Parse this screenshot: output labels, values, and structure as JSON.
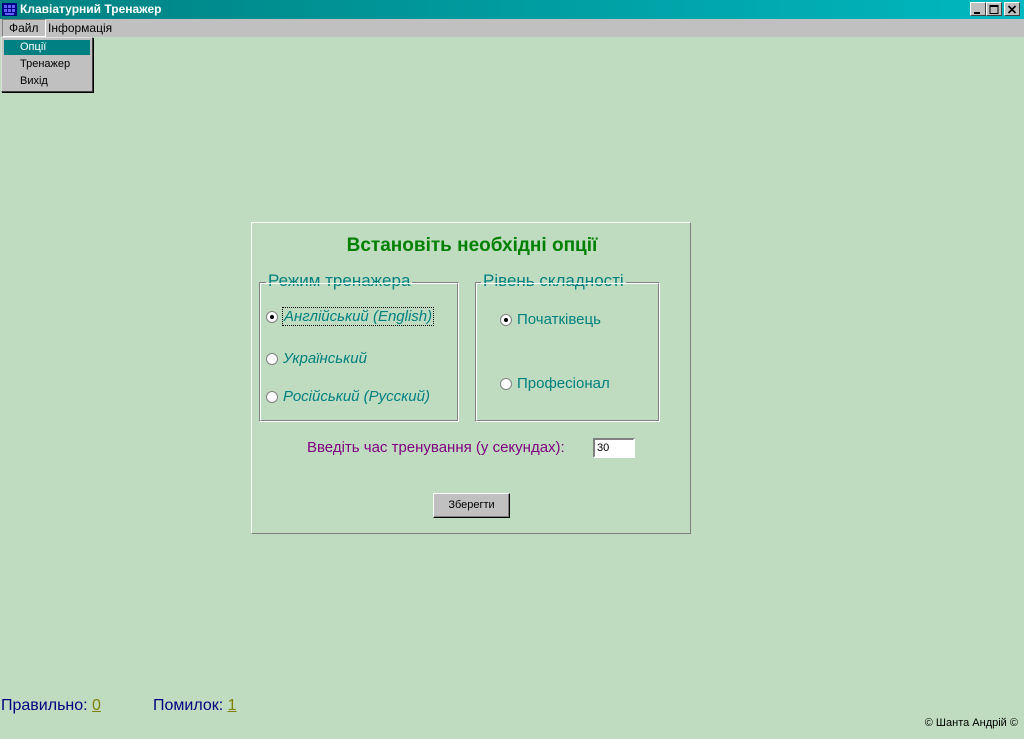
{
  "window": {
    "title": "Клавіатурний Тренажер",
    "icon": "keyboard-app-icon"
  },
  "menubar": {
    "items": [
      "Файл",
      "Інформація"
    ]
  },
  "file_menu": {
    "items": [
      "Опції",
      "Тренажер",
      "Вихід"
    ],
    "selected": "Опції"
  },
  "options": {
    "title": "Встановіть необхідні опції",
    "mode_group": {
      "legend": "Режим тренажера",
      "options": [
        "Англійський (English)",
        "Український",
        "Російський (Русский)"
      ],
      "selected": "Англійський (English)"
    },
    "level_group": {
      "legend": "Рівень складності",
      "options": [
        "Початківець",
        "Професіонал"
      ],
      "selected": "Початківець"
    },
    "time_label": "Введіть час тренування (у секундах):",
    "time_value": "30",
    "save_label": "Зберегти"
  },
  "status": {
    "correct_label": "Правильно:",
    "correct_value": "0",
    "errors_label": "Помилок:",
    "errors_value": "1"
  },
  "copyright": "© Шанта Андрій ©"
}
